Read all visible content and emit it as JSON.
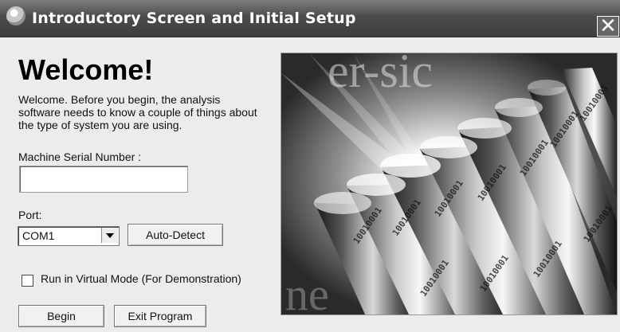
{
  "window": {
    "title": "Introductory Screen and Initial Setup",
    "title_icon": "info-icon",
    "close_symbol": "✕"
  },
  "welcome": {
    "heading": "Welcome!",
    "intro": "Welcome. Before you begin, the analysis software needs to know a couple of things about the type of system you are using."
  },
  "form": {
    "serial_label": "Machine Serial Number :",
    "serial_value": "",
    "port_label": "Port:",
    "port_selected": "COM1",
    "auto_detect_label": "Auto-Detect",
    "virtual_mode_label": "Run in Virtual Mode (For Demonstration)",
    "virtual_mode_checked": false
  },
  "buttons": {
    "begin": "Begin",
    "exit": "Exit Program"
  },
  "colors": {
    "titlebar": "#4b4b4b",
    "window_bg": "#ececec",
    "button_bg": "#f1f1f1"
  },
  "image": {
    "visible_text": [
      "er-sic",
      "ne"
    ],
    "code_text": "10010001"
  }
}
